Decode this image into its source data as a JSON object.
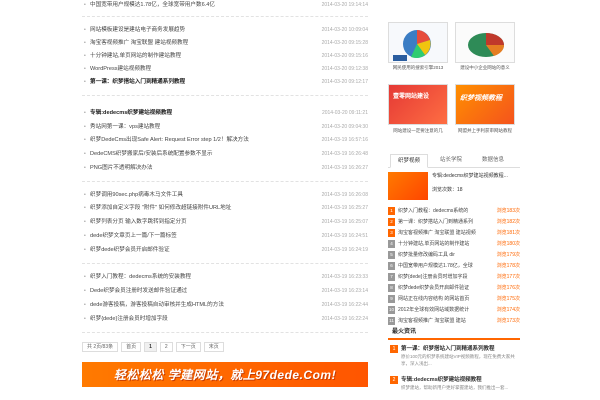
{
  "articles": [
    [
      {
        "title": "中国宽带用户规模达1.78亿，全球宽带用户数6.4亿",
        "date": "2014-03-20 19:14:14",
        "bold": false
      }
    ],
    [
      {
        "title": "网站模板建设是建站电子商务发展趋势",
        "date": "2014-03-20 10:09:04",
        "bold": false
      },
      {
        "title": "淘宝客视频推广 淘宝联盟 建站视频教程",
        "date": "2014-03-20 09:15:28",
        "bold": false
      },
      {
        "title": "十分钟建站,单页网站的制作建站教程",
        "date": "2014-03-20 09:15:16",
        "bold": false
      },
      {
        "title": "WordPress建站视频教程",
        "date": "2014-03-20 09:12:38",
        "bold": false
      },
      {
        "title": "第一课：织梦搭站入门到精通系列教程",
        "date": "2014-03-20 09:12:17",
        "bold": true
      }
    ],
    [
      {
        "title": "专辑:dedecms织梦建站视频教程",
        "date": "2014-03-20 09:11:21",
        "bold": true
      },
      {
        "title": "秀站网第一课：vps建站教程",
        "date": "2014-03-20 09:04:30",
        "bold": false
      },
      {
        "title": "织梦DedeCms出现Safe Alert: Request Error step 1/2！解决方法",
        "date": "2014-03-19 16:57:16",
        "bold": false
      },
      {
        "title": "DedeCMS织梦搬家后/安装后系统配置参数不显示",
        "date": "2014-03-19 16:26:48",
        "bold": false
      },
      {
        "title": "PNG图片不透明解决办法",
        "date": "2014-03-19 16:26:27",
        "bold": false
      }
    ],
    [
      {
        "title": "织梦调用90sec.php病毒木马文件工具",
        "date": "2014-03-19 16:26:08",
        "bold": false
      },
      {
        "title": "织梦添加自定义字段 \"附件\" 如何修改超链接附件URL地址",
        "date": "2014-03-19 16:25:27",
        "bold": false
      },
      {
        "title": "织梦列表分页 输入数字跳转到指定分页",
        "date": "2014-03-19 16:25:07",
        "bold": false
      },
      {
        "title": "dede织梦文章页上一篇/下一篇标签",
        "date": "2014-03-19 16:24:51",
        "bold": false
      },
      {
        "title": "织梦dede织梦会员开启邮件验证",
        "date": "2014-03-19 16:24:19",
        "bold": false
      }
    ],
    [
      {
        "title": "织梦入门教程：dedecms系统的安装教程",
        "date": "2014-03-19 16:23:33",
        "bold": false
      },
      {
        "title": "Dede织梦会员注册时发送邮件验证通过",
        "date": "2014-03-19 16:23:14",
        "bold": false
      },
      {
        "title": "dede游客投稿，游客投稿自动审核并生成HTML的方法",
        "date": "2014-03-19 16:22:44",
        "bold": false
      },
      {
        "title": "织梦{dede}注册会员时增加字段",
        "date": "2014-03-19 16:22:24",
        "bold": false
      }
    ]
  ],
  "pager": {
    "total": "共 2页/83条",
    "first": "首页",
    "page1": "1",
    "page2": "2",
    "next": "下一页",
    "last": "末页"
  },
  "banner": {
    "text": "轻松松松 学建网站，就上97dede.Com!"
  },
  "sidebar": {
    "thumbs": [
      {
        "caption": "网民使用的搜索引擎2013",
        "badge": ""
      },
      {
        "caption": "建设中小企业网站的意义",
        "badge": ""
      },
      {
        "caption": "网站建设一定要注意的几",
        "badge": "壹零网站建设"
      },
      {
        "caption": "网盟并上手利获审网站教程",
        "badge": "织梦视频教程"
      }
    ],
    "tabs": [
      "织梦视频",
      "站长学院",
      "数据信息"
    ],
    "feature": {
      "title": "专辑:dedecms织梦建站视频教程...",
      "views": "浏览次数：18"
    },
    "ranks": [
      {
        "title": "织梦入门教程：dedecms系统的",
        "views": "浏览183次"
      },
      {
        "title": "第一课：织梦搭站入门到精通系列",
        "views": "浏览182次"
      },
      {
        "title": "淘宝客视频推广 淘宝联盟 建站视频",
        "views": "浏览181次"
      },
      {
        "title": "十分钟建站,单页网站的制作建站",
        "views": "浏览180次"
      },
      {
        "title": "织梦批量修改编码工具 dir",
        "views": "浏览179次"
      },
      {
        "title": "中国宽带用户规模达1.78亿，全球",
        "views": "浏览178次"
      },
      {
        "title": "织梦{dede}注册会员时增加字段",
        "views": "浏览177次"
      },
      {
        "title": "织梦dede织梦会员开启邮件验证",
        "views": "浏览176次"
      },
      {
        "title": "网站正在线内容结构 的网站首页",
        "views": "浏览175次"
      },
      {
        "title": "2012年全球有效网站域数据统计",
        "views": "浏览174次"
      },
      {
        "title": "淘宝客视频推广 淘宝联盟 建站",
        "views": "浏览173次"
      }
    ],
    "hot_title": "最火资讯",
    "hot": [
      {
        "num": "1",
        "title": "第一课：织梦搭站入门到精通系列教程",
        "desc": "原价100元的织梦系统建站VIP视频教程，现在免费大家共享，深入浅出..."
      },
      {
        "num": "2",
        "title": "专辑:dedecms织梦建站视频教程",
        "desc": "织梦建站，帮助新用户更好掌握建站，我们推出一套..."
      }
    ]
  },
  "colors": {
    "accent": "#ff6600",
    "link": "#444444",
    "date": "#aaaaaa"
  }
}
